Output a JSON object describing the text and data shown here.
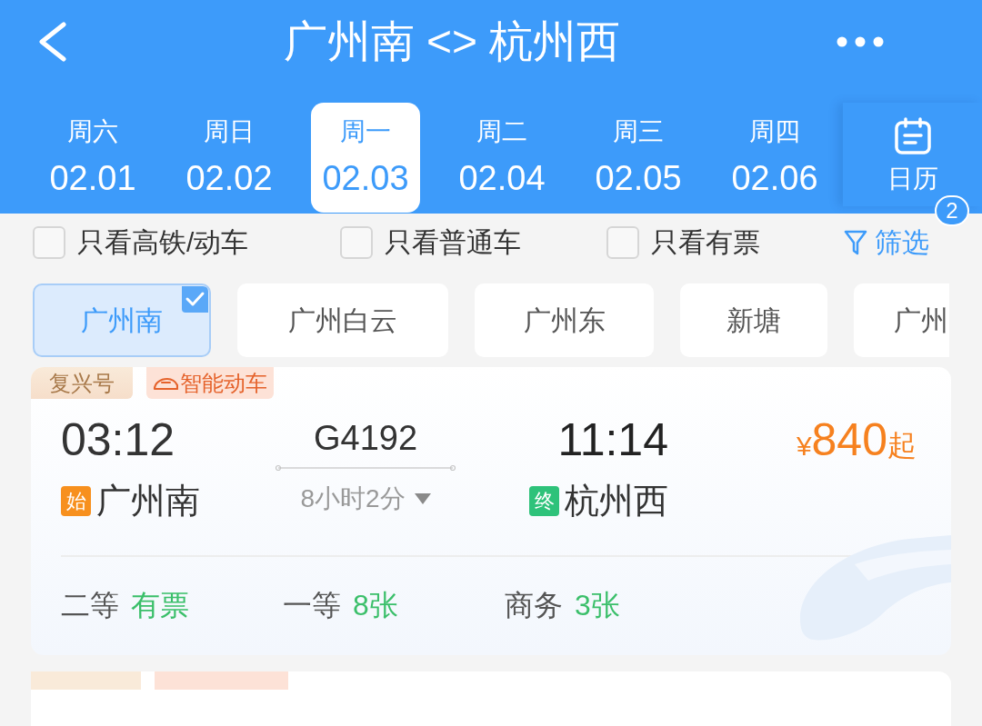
{
  "header": {
    "title": "广州南 <> 杭州西"
  },
  "date_tabs": [
    {
      "weekday": "周六",
      "date": "02.01",
      "selected": false
    },
    {
      "weekday": "周日",
      "date": "02.02",
      "selected": false
    },
    {
      "weekday": "周一",
      "date": "02.03",
      "selected": true
    },
    {
      "weekday": "周二",
      "date": "02.04",
      "selected": false
    },
    {
      "weekday": "周三",
      "date": "02.05",
      "selected": false
    },
    {
      "weekday": "周四",
      "date": "02.06",
      "selected": false
    }
  ],
  "calendar_button": {
    "label": "日历"
  },
  "filters": [
    {
      "label": "只看高铁/动车",
      "checked": false
    },
    {
      "label": "只看普通车",
      "checked": false
    },
    {
      "label": "只看有票",
      "checked": false
    }
  ],
  "filter_button": {
    "label": "筛选",
    "badge": "2"
  },
  "stations": [
    {
      "label": "广州南",
      "selected": true
    },
    {
      "label": "广州白云",
      "selected": false
    },
    {
      "label": "广州东",
      "selected": false
    },
    {
      "label": "新塘",
      "selected": false
    },
    {
      "label": "广州",
      "selected": false
    }
  ],
  "trains": [
    {
      "tags": [
        {
          "kind": "brand",
          "label": "复兴号"
        },
        {
          "kind": "smart",
          "label": "智能动车"
        }
      ],
      "depart_time": "03:12",
      "train_no": "G4192",
      "arrive_time": "11:14",
      "price_symbol": "¥",
      "price": "840",
      "price_suffix": "起",
      "from_badge": "始",
      "from": "广州南",
      "duration": "8小时2分",
      "to_badge": "终",
      "to": "杭州西",
      "seats": [
        {
          "class": "二等",
          "availability": "有票"
        },
        {
          "class": "一等",
          "availability": "8张"
        },
        {
          "class": "商务",
          "availability": "3张"
        }
      ]
    }
  ]
}
